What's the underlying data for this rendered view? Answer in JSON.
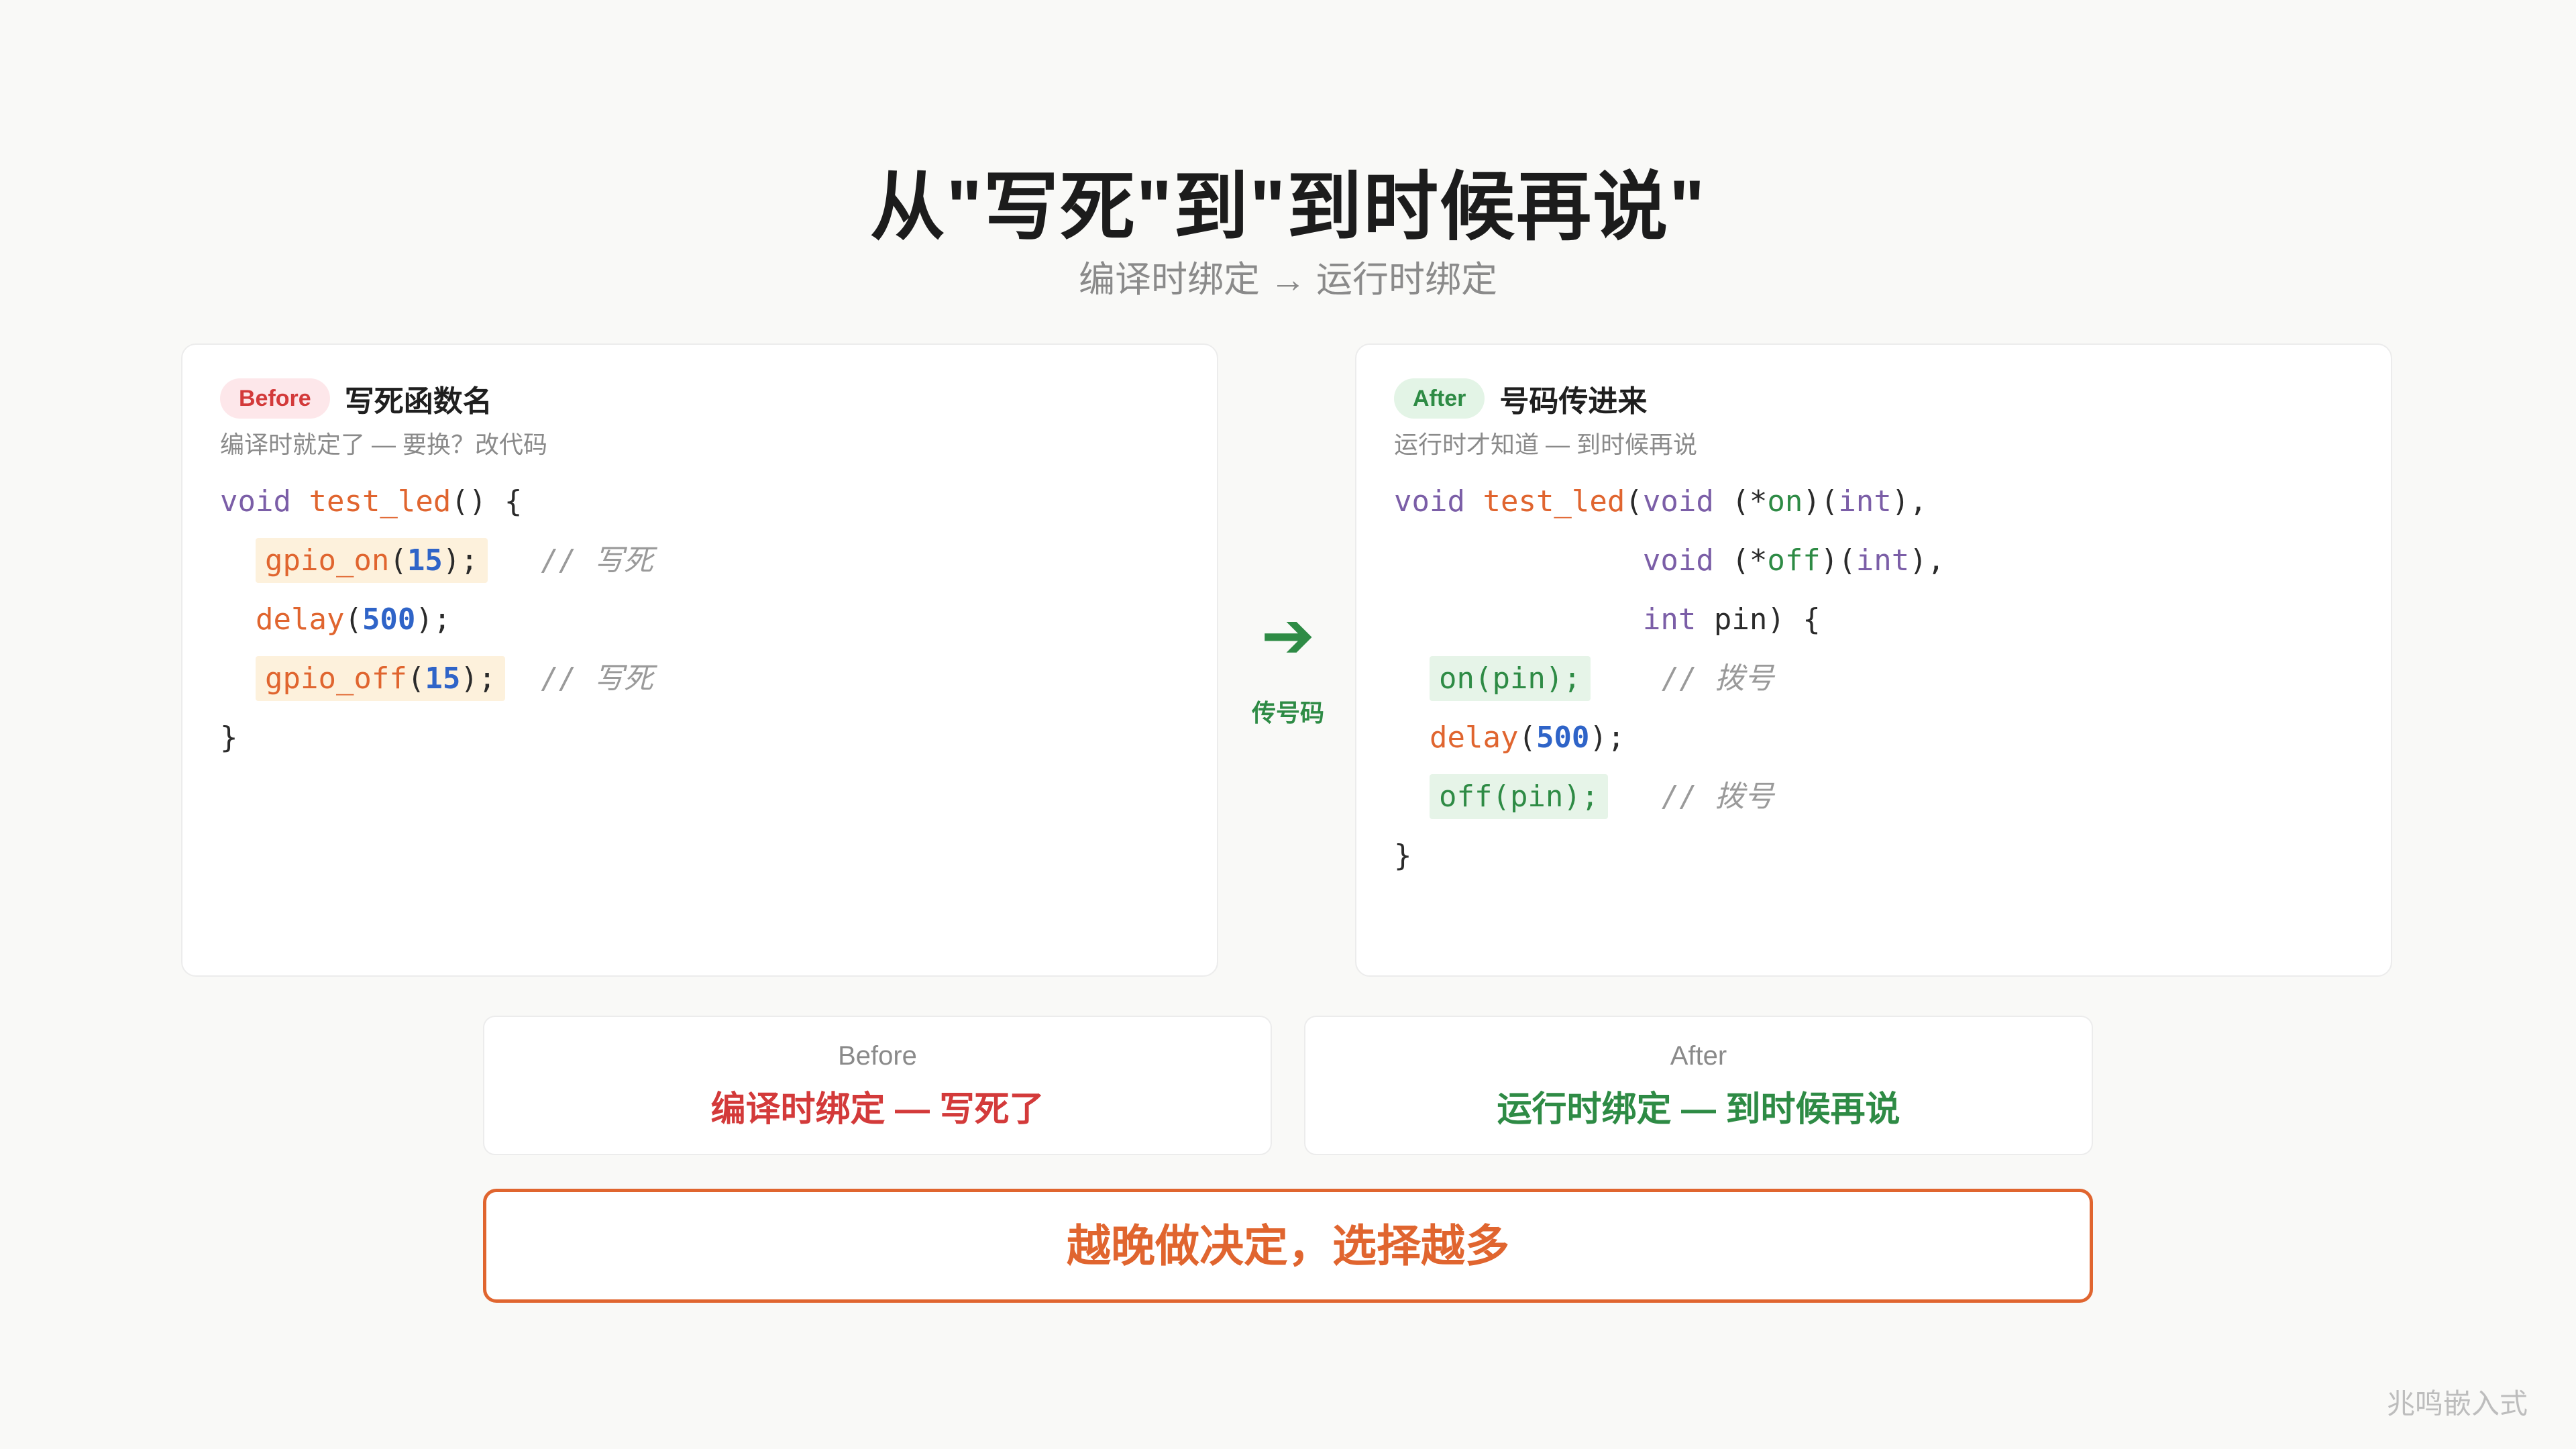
{
  "title": "从\"写死\"到\"到时候再说\"",
  "subtitle": "编译时绑定 → 运行时绑定",
  "before_panel": {
    "badge": "Before",
    "title": "写死函数名",
    "subtitle": "编译时就定了 — 要换？改代码",
    "code": {
      "l1_kw": "void",
      "l1_fn": "test_led",
      "l1_rest": "() {",
      "l2_fn": "gpio_on",
      "l2_open": "(",
      "l2_num": "15",
      "l2_close": ");",
      "l2_comment": "// 写死",
      "l3_fn": "delay",
      "l3_open": "(",
      "l3_num": "500",
      "l3_close": ");",
      "l4_fn": "gpio_off",
      "l4_open": "(",
      "l4_num": "15",
      "l4_close": ");",
      "l4_comment": "// 写死",
      "l5": "}"
    }
  },
  "arrow": {
    "glyph": "➔",
    "label": "传号码"
  },
  "after_panel": {
    "badge": "After",
    "title": "号码传进来",
    "subtitle": "运行时才知道 — 到时候再说",
    "code": {
      "l1_kw": "void",
      "l1_fn": "test_led",
      "l1_a": "(",
      "l1_kw2": "void",
      "l1_b": " (*",
      "l1_g": "on",
      "l1_c": ")(",
      "l1_kw3": "int",
      "l1_d": "),",
      "l2_kw": "void",
      "l2_b": " (*",
      "l2_g": "off",
      "l2_c": ")(",
      "l2_kw2": "int",
      "l2_d": "),",
      "l3_kw": "int",
      "l3_rest": " pin) {",
      "l4_code": "on(pin);",
      "l4_comment": "// 拨号",
      "l5_fn": "delay",
      "l5_open": "(",
      "l5_num": "500",
      "l5_close": ");",
      "l6_code": "off(pin);",
      "l6_comment": "// 拨号",
      "l7": "}"
    }
  },
  "summary": {
    "before_label": "Before",
    "before_value": "编译时绑定 — 写死了",
    "after_label": "After",
    "after_value": "运行时绑定 — 到时候再说"
  },
  "conclusion": "越晚做决定，选择越多",
  "watermark": "兆鸣嵌入式",
  "colors": {
    "accent_orange": "#e0652f",
    "before_red": "#d33a3a",
    "after_green": "#2e8b45",
    "keyword_purple": "#7b5ea7",
    "number_blue": "#2f64c8"
  }
}
